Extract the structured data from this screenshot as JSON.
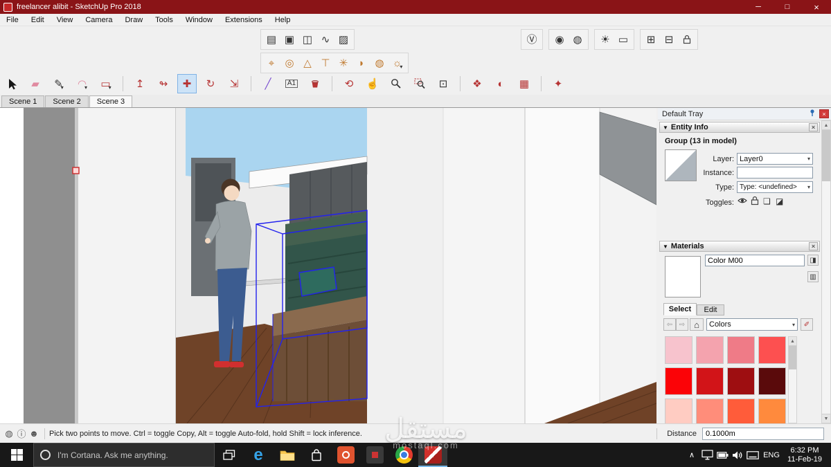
{
  "window": {
    "title": "freelancer alibit - SketchUp Pro 2018"
  },
  "menu": {
    "items": [
      "File",
      "Edit",
      "View",
      "Camera",
      "Draw",
      "Tools",
      "Window",
      "Extensions",
      "Help"
    ]
  },
  "scene_tabs": [
    "Scene 1",
    "Scene 2",
    "Scene 3"
  ],
  "icons": {
    "minimize": "─",
    "maximize": "□",
    "close": "×",
    "caret": "▾",
    "up": "▲",
    "down": "▼",
    "row1": [
      "▤",
      "▣",
      "◫",
      "∿",
      "▨"
    ],
    "vray": [
      "Ⓥ",
      "◉",
      "◍",
      "☀",
      "▭",
      "⊞",
      "⊟"
    ],
    "sandbox": [
      "⌖",
      "◎",
      "△",
      "⊤",
      "✳",
      "◗",
      "◍",
      "☼"
    ],
    "eraser": "▰",
    "pencil": "✎",
    "arc": "◠",
    "shape": "▭",
    "pushpull": "↥",
    "followme": "↬",
    "move": "✚",
    "rotate": "↻",
    "scale": "⇲",
    "tape": "╱",
    "text": "A1",
    "orbit": "⟲",
    "pan": "☝",
    "extents": "⊡",
    "styles": "❖",
    "shadows": "◐",
    "layers": "▦",
    "extension": "✦",
    "back": "⇦",
    "forward": "⇨",
    "home": "⌂",
    "pane": "◨",
    "roller": "▥",
    "dropper": "✐",
    "toggle_hide": "❏",
    "toggle_shadow": "◪",
    "geo": "◍",
    "info": "ⓘ",
    "user": "☻",
    "chevron_up": "∧",
    "edge": "e"
  },
  "tray": {
    "title": "Default Tray",
    "entity_info": {
      "title": "Entity Info",
      "group_label": "Group (13 in model)",
      "layer_label": "Layer:",
      "layer_value": "Layer0",
      "instance_label": "Instance:",
      "type_label": "Type:",
      "type_value": "Type: <undefined>",
      "toggles_label": "Toggles:"
    },
    "materials": {
      "title": "Materials",
      "name_value": "Color M00",
      "tabs": [
        "Select",
        "Edit"
      ],
      "collection_value": "Colors",
      "swatches": [
        "#f7c3cd",
        "#f4a3ae",
        "#ef7b87",
        "#fd5050",
        "#fb0307",
        "#d21418",
        "#9e0e11",
        "#5a0a0b",
        "#ffccc2",
        "#ff8d7a",
        "#ff5c3a",
        "#ff8a3d"
      ]
    }
  },
  "status": {
    "hint": "Pick two points to move.  Ctrl = toggle Copy, Alt = toggle Auto-fold, hold Shift = lock inference.",
    "measure_label": "Distance",
    "measure_value": "0.1000m"
  },
  "taskbar": {
    "search_placeholder": "I'm Cortana. Ask me anything.",
    "language": "ENG",
    "time": "6:32 PM",
    "date": "11-Feb-19"
  },
  "watermark": {
    "arabic": "مستقل",
    "latin": "mostaql.com"
  }
}
